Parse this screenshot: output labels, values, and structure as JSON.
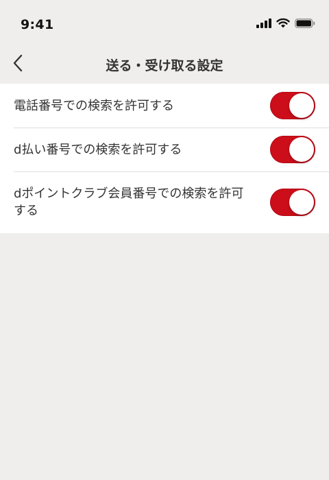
{
  "status_bar": {
    "time": "9:41",
    "icons": [
      "signal-icon",
      "wifi-icon",
      "battery-icon"
    ]
  },
  "nav": {
    "back_icon": "chevron-left-icon",
    "title": "送る・受け取る設定"
  },
  "settings": [
    {
      "label": "電話番号での検索を許可する",
      "enabled": true
    },
    {
      "label": "d払い番号での検索を許可する",
      "enabled": true
    },
    {
      "label": "dポイントクラブ会員番号での検索を許可する",
      "enabled": true
    }
  ],
  "colors": {
    "toggle_on": "#cc0e1b",
    "background": "#efeeec",
    "list_background": "#ffffff",
    "text": "#333333"
  }
}
